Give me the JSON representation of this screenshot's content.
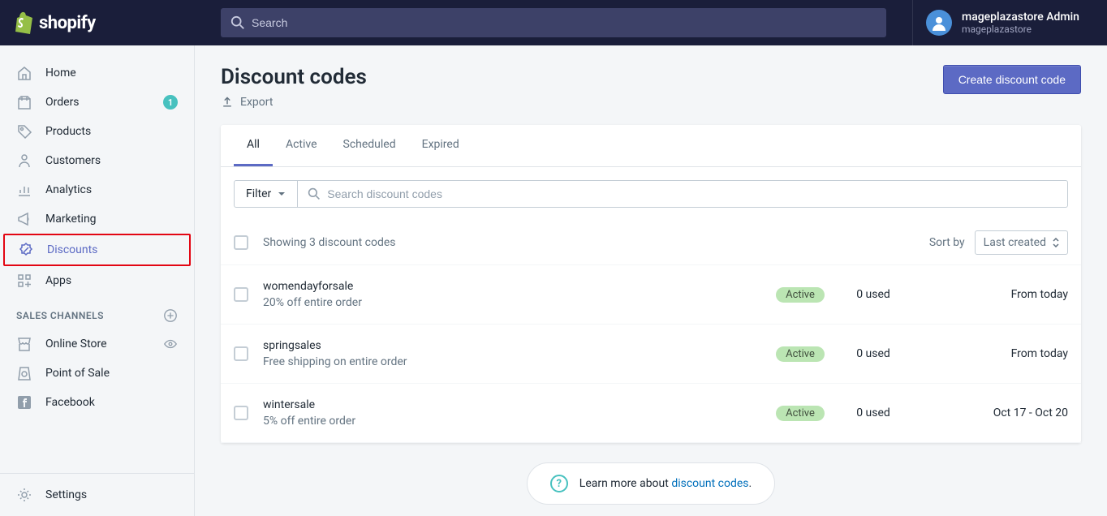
{
  "brand": "shopify",
  "search": {
    "placeholder": "Search"
  },
  "user": {
    "name": "mageplazastore Admin",
    "store": "mageplazastore"
  },
  "nav": {
    "home": "Home",
    "orders": "Orders",
    "orders_badge": "1",
    "products": "Products",
    "customers": "Customers",
    "analytics": "Analytics",
    "marketing": "Marketing",
    "discounts": "Discounts",
    "apps": "Apps",
    "sales_channels": "SALES CHANNELS",
    "online_store": "Online Store",
    "pos": "Point of Sale",
    "facebook": "Facebook",
    "settings": "Settings"
  },
  "page": {
    "title": "Discount codes",
    "export": "Export",
    "create_btn": "Create discount code"
  },
  "tabs": {
    "all": "All",
    "active": "Active",
    "scheduled": "Scheduled",
    "expired": "Expired"
  },
  "filter": {
    "label": "Filter",
    "search_placeholder": "Search discount codes"
  },
  "list": {
    "showing": "Showing 3 discount codes",
    "sort_by": "Sort by",
    "sort_value": "Last created",
    "rows": [
      {
        "title": "womendayforsale",
        "sub": "20% off entire order",
        "status": "Active",
        "used": "0 used",
        "date": "From today"
      },
      {
        "title": "springsales",
        "sub": "Free shipping on entire order",
        "status": "Active",
        "used": "0 used",
        "date": "From today"
      },
      {
        "title": "wintersale",
        "sub": "5% off entire order",
        "status": "Active",
        "used": "0 used",
        "date": "Oct 17 - Oct 20"
      }
    ]
  },
  "learn": {
    "prefix": "Learn more about ",
    "link": "discount codes",
    "suffix": "."
  }
}
